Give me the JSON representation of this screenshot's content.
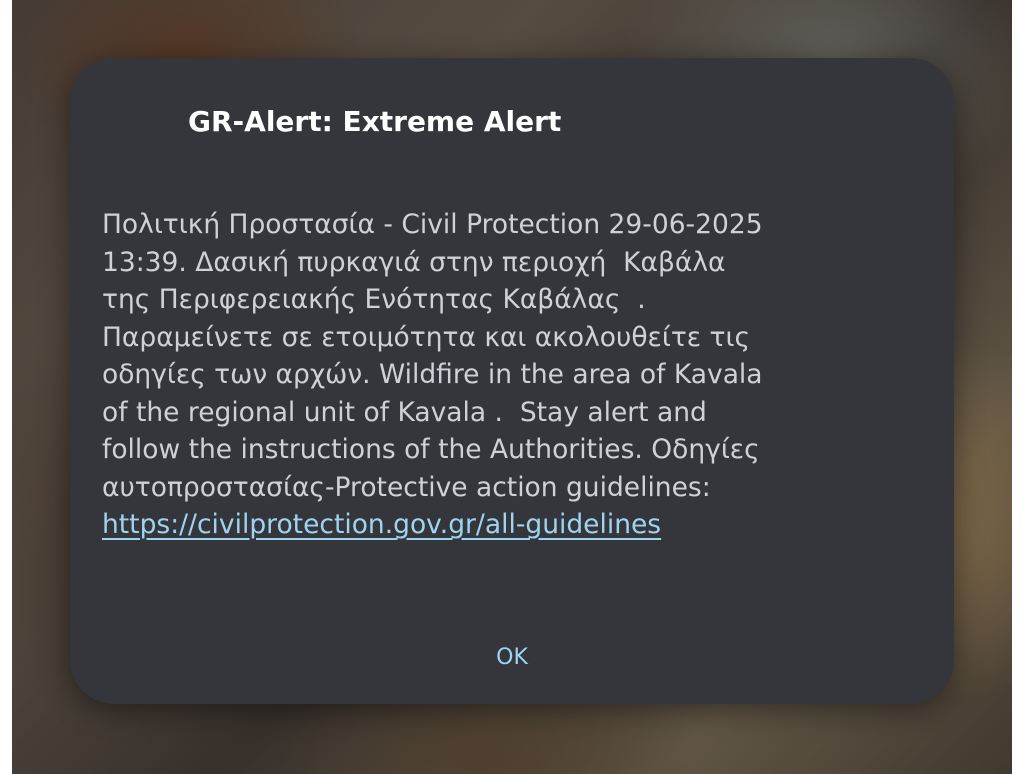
{
  "dialog": {
    "title": "GR-Alert: Extreme Alert",
    "body_lines": [
      "Πολιτική Προστασία - Civil Protection 29-06-2025",
      "13:39. Δασική πυρκαγιά στην περιοχή  Καβάλα",
      "της Περιφερειακής Ενότητας Καβάλας  .",
      "Παραμείνετε σε ετοιμότητα και ακολουθείτε τις",
      "οδηγίες των αρχών. Wildfire in the area of Kavala",
      "of the regional unit of Kavala .  Stay alert and",
      "follow the instructions of the Authorities. Οδηγίες",
      "αυτοπροστασίας-Protective action guidelines:"
    ],
    "link": "https://civilprotection.gov.gr/all-guidelines",
    "ok_label": "OK"
  },
  "colors": {
    "dialog_background": "#34363c",
    "title_text": "#ffffff",
    "body_text": "#cfd1d6",
    "accent": "#9fd3ee"
  }
}
